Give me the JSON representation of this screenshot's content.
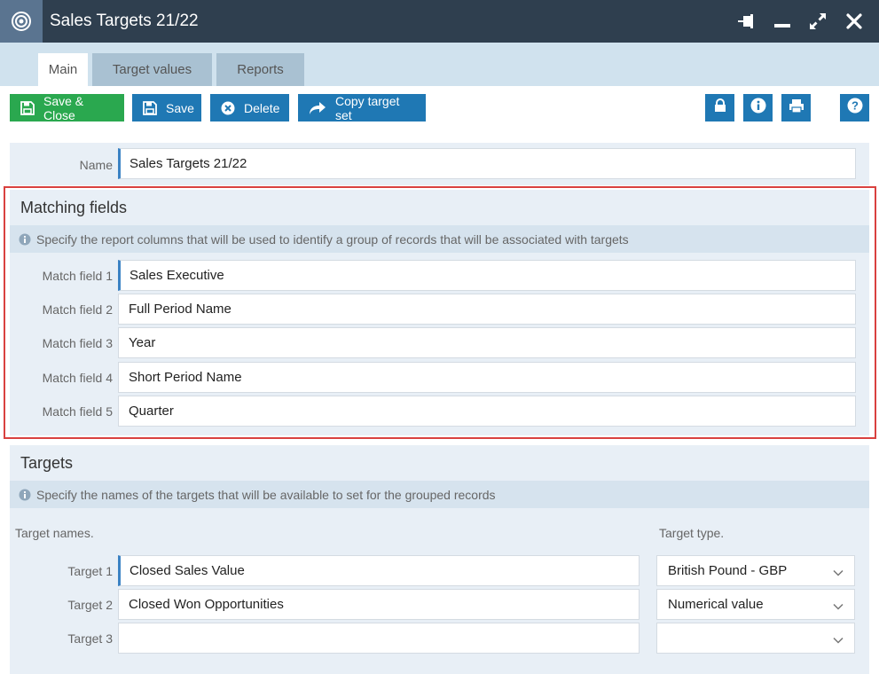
{
  "window": {
    "title": "Sales Targets 21/22",
    "app_icon": "target-icon",
    "controls": [
      "pin-icon",
      "minimize-icon",
      "maximize-icon",
      "close-icon"
    ]
  },
  "tabs": [
    {
      "label": "Main",
      "active": true
    },
    {
      "label": "Target values",
      "active": false
    },
    {
      "label": "Reports",
      "active": false
    }
  ],
  "toolbar": {
    "save_close_label": "Save & Close",
    "save_label": "Save",
    "delete_label": "Delete",
    "copy_label": "Copy target set",
    "right_icons": [
      "lock-icon",
      "info-icon",
      "print-icon",
      "help-icon"
    ]
  },
  "name": {
    "label": "Name",
    "value": "Sales Targets 21/22"
  },
  "matching": {
    "title": "Matching fields",
    "info": "Specify the report columns that will be used to identify a group of records that will be associated with targets",
    "fields": [
      {
        "label": "Match field 1",
        "value": "Sales Executive"
      },
      {
        "label": "Match field 2",
        "value": "Full Period Name"
      },
      {
        "label": "Match field 3",
        "value": "Year"
      },
      {
        "label": "Match field 4",
        "value": "Short Period Name"
      },
      {
        "label": "Match field 5",
        "value": "Quarter"
      }
    ]
  },
  "targets": {
    "title": "Targets",
    "info": "Specify the names of the targets that will be available to set for the grouped records",
    "names_header": "Target names.",
    "type_header": "Target type.",
    "rows": [
      {
        "label": "Target 1",
        "value": "Closed Sales Value",
        "type": "British Pound - GBP"
      },
      {
        "label": "Target 2",
        "value": "Closed Won Opportunities",
        "type": "Numerical value"
      },
      {
        "label": "Target 3",
        "value": "",
        "type": ""
      }
    ]
  },
  "colors": {
    "titlebar": "#2f3f4f",
    "green": "#2aa84f",
    "blue": "#1f78b4",
    "highlight": "#d9413f"
  }
}
